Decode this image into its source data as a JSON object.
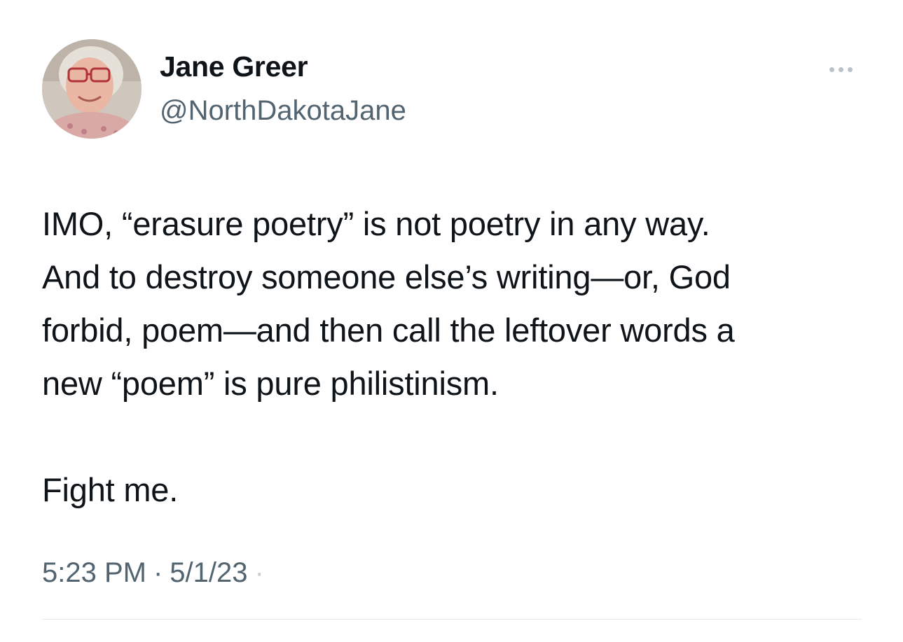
{
  "author": {
    "display_name": "Jane Greer",
    "handle": "@NorthDakotaJane",
    "avatar_icon": "profile-photo"
  },
  "tweet": {
    "lines": [
      "IMO, “erasure poetry” is not poetry in any way.",
      "And to destroy someone else’s writing—or, God",
      "forbid, poem—and then call the leftover words a",
      "new “poem” is pure philistinism."
    ],
    "closing": "Fight me."
  },
  "meta": {
    "time": "5:23 PM",
    "separator": "·",
    "date": "5/1/23"
  },
  "more_icon": "more-horizontal-icon",
  "colors": {
    "text_primary": "#0f1419",
    "text_secondary": "#536471",
    "divider": "#e6eaed"
  }
}
